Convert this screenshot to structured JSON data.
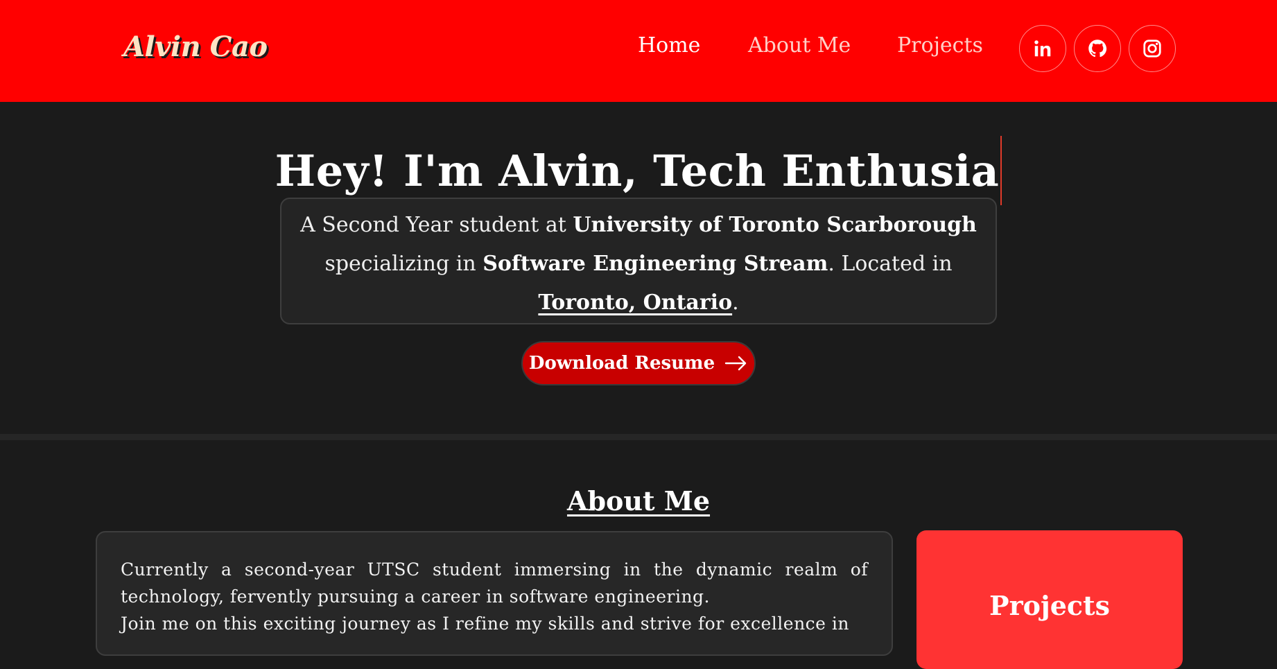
{
  "header": {
    "logo": "Alvin Cao",
    "nav": [
      {
        "label": "Home",
        "active": true
      },
      {
        "label": "About Me",
        "active": false
      },
      {
        "label": "Projects",
        "active": false
      }
    ],
    "social": [
      "linkedin-icon",
      "github-icon",
      "instagram-icon"
    ],
    "background_color": "#ff0000"
  },
  "hero": {
    "title": "Hey! I'm Alvin, Tech Enthusia",
    "intro": {
      "p1": "A Second Year student at ",
      "school": "University of Toronto Scarborough",
      "p2": " specializing in ",
      "stream": "Software Engineering Stream",
      "p3": ". Located in ",
      "location": "Toronto, Ontario",
      "p4": "."
    },
    "resume_button": "Download Resume"
  },
  "about": {
    "heading": "About Me",
    "paragraph1": "Currently a second-year UTSC student immersing in the dynamic realm of technology, fervently pursuing a career in software engineering.",
    "paragraph2": "Join me on this exciting journey as I refine my skills and strive for excellence in"
  },
  "projects_card": {
    "title": "Projects",
    "color": "#ff3333"
  }
}
